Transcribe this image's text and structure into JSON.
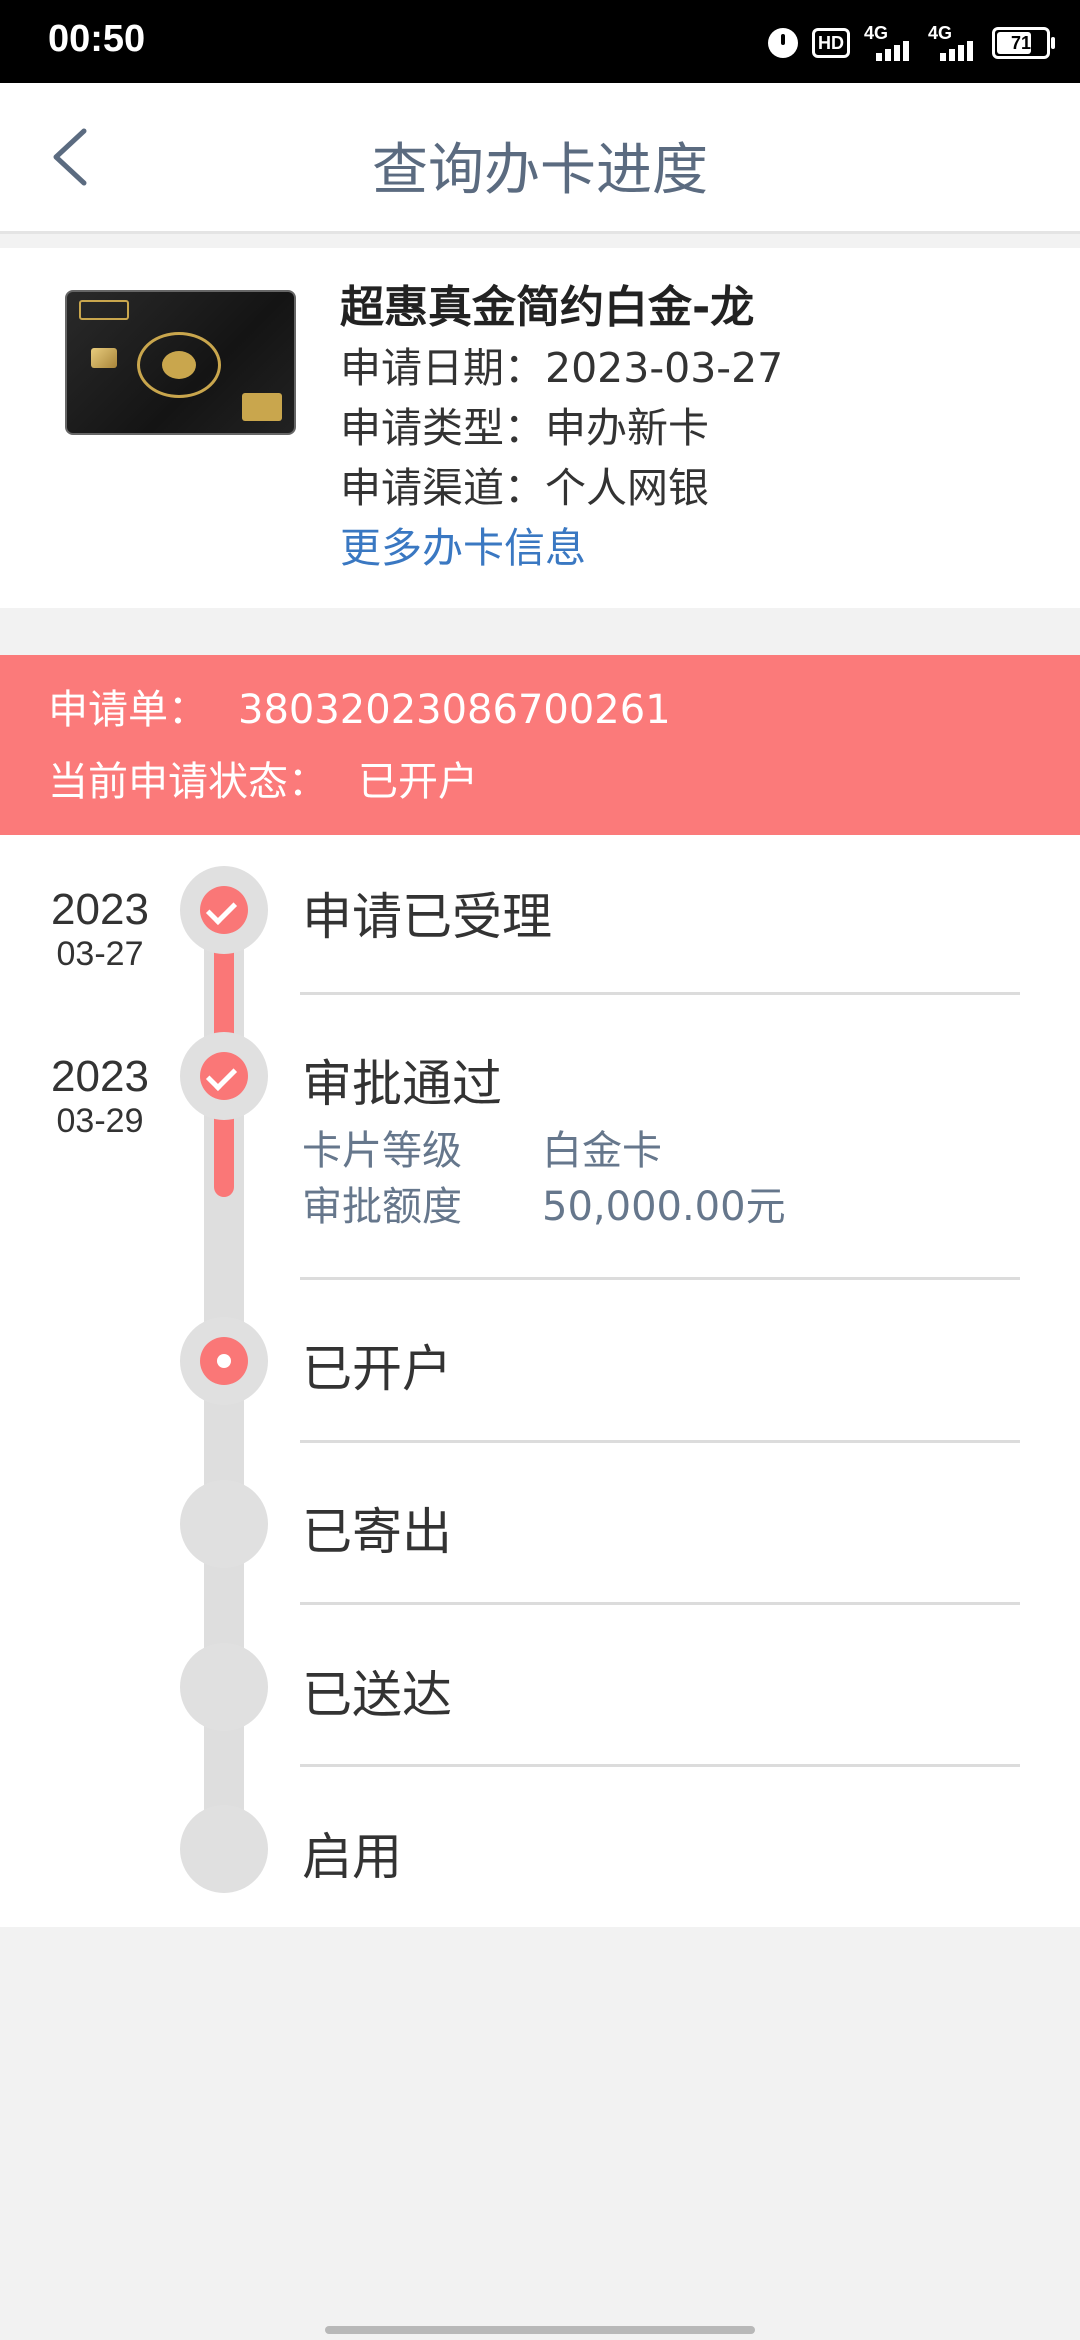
{
  "status_bar": {
    "time": "00:50",
    "hd_label": "HD",
    "network_1": "4G",
    "network_2": "4G",
    "battery": "71",
    "battery_level_percent": 71
  },
  "header": {
    "title": "查询办卡进度",
    "back_icon": "chevron-left-icon"
  },
  "card": {
    "name": "超惠真金简约白金-龙",
    "apply_date": "申请日期：2023-03-27",
    "apply_type": "申请类型：申办新卡",
    "apply_channel": "申请渠道：个人网银",
    "more_link": "更多办卡信息"
  },
  "banner": {
    "order_label": "申请单：",
    "order_value": "38032023086700261",
    "status_label": "当前申请状态：",
    "status_value": "已开户",
    "color": "#fb7a7a"
  },
  "timeline": {
    "accent_color": "#fa7777",
    "steps": [
      {
        "title": "申请已受理",
        "year": "2023",
        "md": "03-27",
        "state": "done"
      },
      {
        "title": "审批通过",
        "year": "2023",
        "md": "03-29",
        "state": "done",
        "details": [
          {
            "label": "卡片等级",
            "value": "白金卡"
          },
          {
            "label": "审批额度",
            "value": "50,000.00元"
          }
        ]
      },
      {
        "title": "已开户",
        "state": "current"
      },
      {
        "title": "已寄出",
        "state": "pending"
      },
      {
        "title": "已送达",
        "state": "pending"
      },
      {
        "title": "启用",
        "state": "pending"
      }
    ]
  }
}
